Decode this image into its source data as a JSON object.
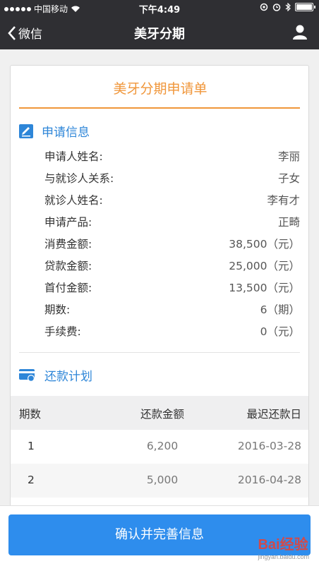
{
  "status": {
    "carrier": "中国移动",
    "time": "下午4:49"
  },
  "nav": {
    "back_label": "微信",
    "title": "美牙分期"
  },
  "form": {
    "title": "美牙分期申请单"
  },
  "info": {
    "heading": "申请信息",
    "rows": [
      {
        "label": "申请人姓名:",
        "value": "李丽"
      },
      {
        "label": "与就诊人关系:",
        "value": "子女"
      },
      {
        "label": "就诊人姓名:",
        "value": "李有才"
      },
      {
        "label": "申请产品:",
        "value": "正畸"
      },
      {
        "label": "消费金额:",
        "value": "38,500（元）"
      },
      {
        "label": "贷款金额:",
        "value": "25,000（元）"
      },
      {
        "label": "首付金额:",
        "value": "13,500（元）"
      },
      {
        "label": "期数:",
        "value": "6（期）"
      },
      {
        "label": "手续费:",
        "value": "0（元）"
      }
    ]
  },
  "plan": {
    "heading": "还款计划",
    "columns": [
      "期数",
      "还款金额",
      "最迟还款日"
    ],
    "rows": [
      [
        "1",
        "6,200",
        "2016-03-28"
      ],
      [
        "2",
        "5,000",
        "2016-04-28"
      ]
    ]
  },
  "actions": {
    "confirm_label": "确认并完善信息"
  },
  "watermark": {
    "brand": "Bai经验",
    "url": "jingyan.baidu.com"
  },
  "colors": {
    "topbar": "#2f2f33",
    "accent_orange": "#f0963a",
    "accent_blue": "#2e86d8",
    "button": "#2e8ded"
  }
}
